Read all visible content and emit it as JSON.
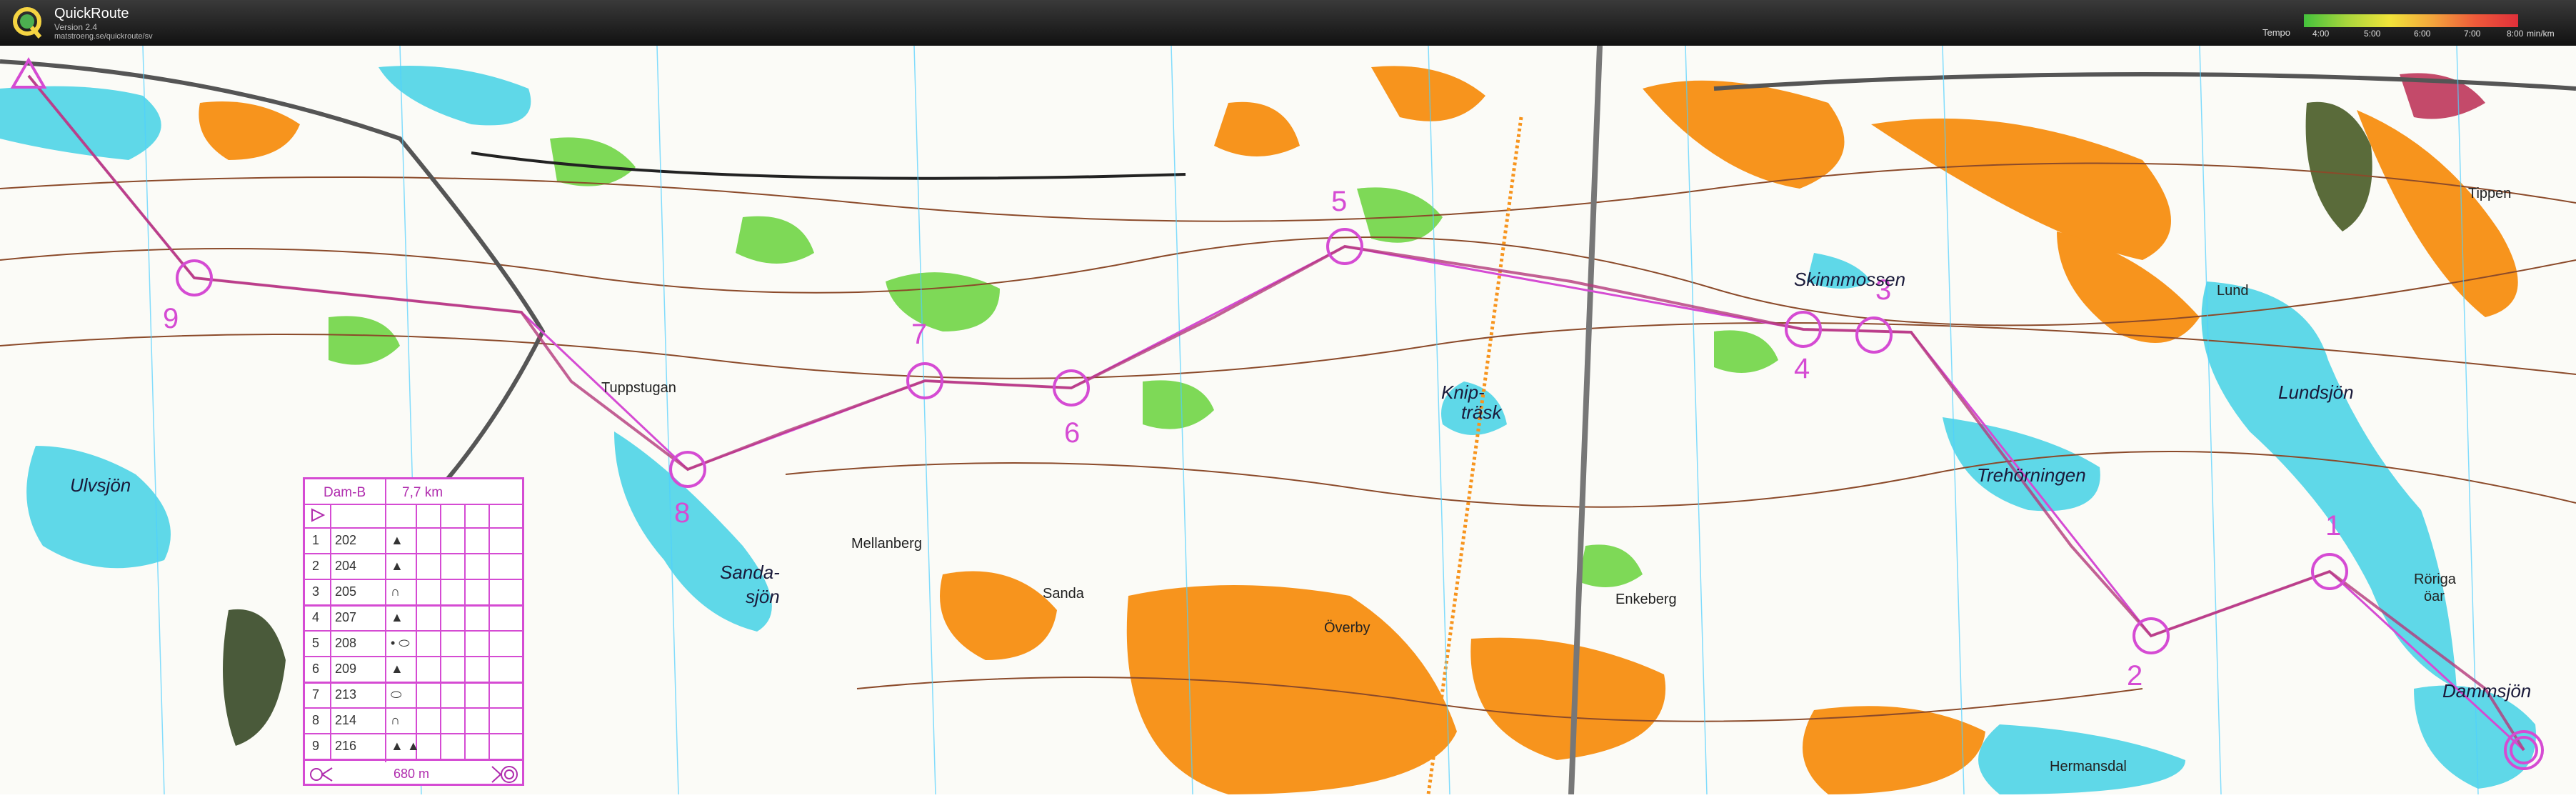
{
  "window": {
    "app_title": "QuickRoute",
    "version": "Version 2.4",
    "url": "matstroeng.se/quickroute/sv"
  },
  "tempo_legend": {
    "label": "Tempo",
    "ticks": [
      "4:00",
      "5:00",
      "6:00",
      "7:00",
      "8:00"
    ],
    "unit": "min/km"
  },
  "colors": {
    "course": "#d54bd3",
    "route_line": "#b43a7a",
    "forest_open": "#f7941d",
    "lake": "#5fd8e8",
    "green": "#7ed957",
    "contour": "#8b4a2a"
  },
  "control_description": {
    "class": "Dam-B",
    "length": "7,7 km",
    "climb": "680 m",
    "rows": [
      {
        "num": "1",
        "code": "202",
        "feature": "▲"
      },
      {
        "num": "2",
        "code": "204",
        "feature": "▲"
      },
      {
        "num": "3",
        "code": "205",
        "feature": "∩"
      },
      {
        "num": "4",
        "code": "207",
        "feature": "▲"
      },
      {
        "num": "5",
        "code": "208",
        "feature": "• ⬭"
      },
      {
        "num": "6",
        "code": "209",
        "feature": "▲"
      },
      {
        "num": "7",
        "code": "213",
        "feature": "⬭"
      },
      {
        "num": "8",
        "code": "214",
        "feature": "∩"
      },
      {
        "num": "9",
        "code": "216",
        "feature": "▲ ▲"
      }
    ]
  },
  "place_names": {
    "ulvsjon": "Ulvsjön",
    "sandasjon_1": "Sanda-",
    "sandasjon_2": "sjön",
    "sanda": "Sanda",
    "mellanberg": "Mellanberg",
    "overby": "Överby",
    "enkeberg": "Enkeberg",
    "knip_1": "Knip-",
    "knip_2": "träsk",
    "skinnmossen": "Skinnmossen",
    "trehorningen": "Trehörningen",
    "lundsjon": "Lundsjön",
    "lund": "Lund",
    "roriga_1": "Röriga",
    "roriga_2": "öar",
    "dammsjon": "Dammsjön",
    "hermansdal": "Hermansdal",
    "tippen": "Tippen",
    "tuppstugan": "Tuppstugan"
  },
  "controls": [
    "1",
    "2",
    "3",
    "4",
    "5",
    "6",
    "7",
    "8",
    "9"
  ]
}
